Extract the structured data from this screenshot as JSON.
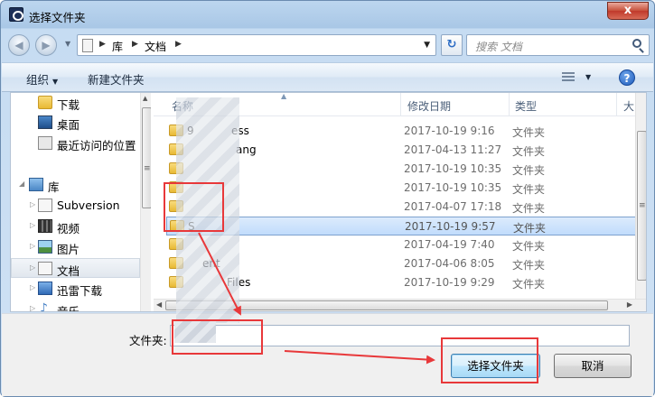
{
  "window": {
    "title": "选择文件夹",
    "close_label": "x"
  },
  "navbar": {
    "path": [
      "库",
      "文档"
    ],
    "search_placeholder": "搜索 文档"
  },
  "toolbar": {
    "organize": "组织",
    "new_folder": "新建文件夹"
  },
  "nav_pane": {
    "items": [
      {
        "label": "下载",
        "icon": "download-folder-icon"
      },
      {
        "label": "桌面",
        "icon": "desktop-icon"
      },
      {
        "label": "最近访问的位置",
        "icon": "recent-places-icon"
      },
      {
        "label": "库",
        "icon": "library-icon"
      },
      {
        "label": "Subversion",
        "icon": "document-icon"
      },
      {
        "label": "视频",
        "icon": "video-icon"
      },
      {
        "label": "图片",
        "icon": "picture-icon"
      },
      {
        "label": "文档",
        "icon": "document-icon"
      },
      {
        "label": "迅雷下载",
        "icon": "download-icon"
      },
      {
        "label": "音乐",
        "icon": "music-icon"
      }
    ]
  },
  "file_list": {
    "columns": {
      "name": "名称",
      "date": "修改日期",
      "type": "类型",
      "size": "大"
    },
    "rows": [
      {
        "name": "9",
        "tail": "ess",
        "date": "2017-10-19 9:16",
        "type": "文件夹"
      },
      {
        "name": "",
        "tail": "ang",
        "date": "2017-04-13 11:27",
        "type": "文件夹"
      },
      {
        "name": "",
        "tail": "",
        "date": "2017-10-19 10:35",
        "type": "文件夹"
      },
      {
        "name": "",
        "tail": "",
        "date": "2017-10-19 10:35",
        "type": "文件夹"
      },
      {
        "name": "",
        "tail": "",
        "date": "2017-04-07 17:18",
        "type": "文件夹"
      },
      {
        "name": "S",
        "tail": "",
        "date": "2017-10-19 9:57",
        "type": "文件夹"
      },
      {
        "name": "",
        "tail": "",
        "date": "2017-04-19 7:40",
        "type": "文件夹"
      },
      {
        "name": "",
        "tail": "ent",
        "date": "2017-04-06 8:05",
        "type": "文件夹"
      },
      {
        "name": "",
        "tail": "Files",
        "date": "2017-10-19 9:29",
        "type": "文件夹"
      }
    ]
  },
  "footer": {
    "folder_label": "文件夹:",
    "folder_value": "",
    "select_button": "选择文件夹",
    "cancel_button": "取消"
  },
  "colors": {
    "annotation": "#e8383a",
    "selection": "#c1dcfc"
  }
}
